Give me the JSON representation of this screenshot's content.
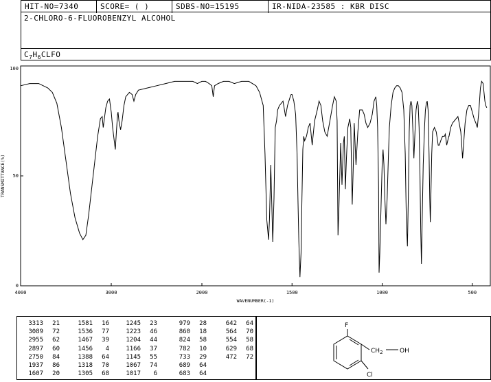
{
  "header": {
    "hit_no": "HIT-NO=7340",
    "score": "SCORE= ( )",
    "sdbs_no": "SDBS-NO=15195",
    "ir_code": "IR-NIDA-23585 : KBR DISC"
  },
  "compound_name": "2-CHLORO-6-FLUOROBENZYL ALCOHOL",
  "formula": {
    "c": "C",
    "c_n": "7",
    "h": "H",
    "h_n": "6",
    "rest": "CLFO"
  },
  "chart_data": {
    "type": "line",
    "xlabel": "WAVENUMBER(-1)",
    "ylabel": "TRANSMITTANCE(%)",
    "xlim": [
      4000,
      400
    ],
    "ylim": [
      0,
      100
    ],
    "x_ticks": [
      "4000",
      "3000",
      "2000",
      "1500",
      "1000",
      "500"
    ],
    "x_tick_values": [
      4000,
      3000,
      2000,
      1500,
      1000,
      500
    ],
    "y_ticks": [
      "100",
      "50",
      "0"
    ],
    "y_tick_values": [
      100,
      50,
      0
    ],
    "series": [
      {
        "points": [
          [
            4000,
            91
          ],
          [
            3900,
            92
          ],
          [
            3800,
            92
          ],
          [
            3750,
            91
          ],
          [
            3700,
            90
          ],
          [
            3650,
            88
          ],
          [
            3600,
            83
          ],
          [
            3550,
            72
          ],
          [
            3500,
            57
          ],
          [
            3450,
            42
          ],
          [
            3400,
            31
          ],
          [
            3350,
            24
          ],
          [
            3313,
            21
          ],
          [
            3280,
            23
          ],
          [
            3250,
            32
          ],
          [
            3200,
            50
          ],
          [
            3150,
            68
          ],
          [
            3120,
            76
          ],
          [
            3100,
            77
          ],
          [
            3089,
            72
          ],
          [
            3070,
            78
          ],
          [
            3060,
            81
          ],
          [
            3040,
            84
          ],
          [
            3020,
            85
          ],
          [
            3000,
            79
          ],
          [
            2985,
            72
          ],
          [
            2955,
            62
          ],
          [
            2940,
            72
          ],
          [
            2930,
            78
          ],
          [
            2925,
            79
          ],
          [
            2915,
            75
          ],
          [
            2897,
            71
          ],
          [
            2880,
            75
          ],
          [
            2860,
            82
          ],
          [
            2840,
            86
          ],
          [
            2800,
            88
          ],
          [
            2770,
            87
          ],
          [
            2750,
            84
          ],
          [
            2730,
            87
          ],
          [
            2700,
            89
          ],
          [
            2600,
            90
          ],
          [
            2500,
            91
          ],
          [
            2400,
            92
          ],
          [
            2300,
            93
          ],
          [
            2200,
            93
          ],
          [
            2100,
            93
          ],
          [
            2050,
            92
          ],
          [
            2000,
            93
          ],
          [
            1980,
            93
          ],
          [
            1960,
            92
          ],
          [
            1945,
            91
          ],
          [
            1937,
            86
          ],
          [
            1930,
            91
          ],
          [
            1910,
            92
          ],
          [
            1880,
            93
          ],
          [
            1850,
            93
          ],
          [
            1820,
            92
          ],
          [
            1780,
            93
          ],
          [
            1740,
            93
          ],
          [
            1720,
            92
          ],
          [
            1700,
            91
          ],
          [
            1680,
            88
          ],
          [
            1660,
            82
          ],
          [
            1650,
            60
          ],
          [
            1640,
            30
          ],
          [
            1630,
            21
          ],
          [
            1625,
            30
          ],
          [
            1618,
            55
          ],
          [
            1607,
            20
          ],
          [
            1600,
            40
          ],
          [
            1593,
            72
          ],
          [
            1586,
            75
          ],
          [
            1580,
            80
          ],
          [
            1570,
            82
          ],
          [
            1560,
            83
          ],
          [
            1550,
            84
          ],
          [
            1536,
            77
          ],
          [
            1525,
            82
          ],
          [
            1510,
            86
          ],
          [
            1505,
            87
          ],
          [
            1500,
            87
          ],
          [
            1490,
            84
          ],
          [
            1480,
            78
          ],
          [
            1472,
            60
          ],
          [
            1467,
            39
          ],
          [
            1462,
            20
          ],
          [
            1456,
            4
          ],
          [
            1450,
            15
          ],
          [
            1445,
            40
          ],
          [
            1440,
            62
          ],
          [
            1435,
            68
          ],
          [
            1430,
            66
          ],
          [
            1420,
            68
          ],
          [
            1410,
            72
          ],
          [
            1400,
            74
          ],
          [
            1388,
            64
          ],
          [
            1375,
            75
          ],
          [
            1360,
            80
          ],
          [
            1350,
            84
          ],
          [
            1340,
            82
          ],
          [
            1330,
            75
          ],
          [
            1318,
            70
          ],
          [
            1305,
            68
          ],
          [
            1290,
            75
          ],
          [
            1275,
            82
          ],
          [
            1265,
            86
          ],
          [
            1255,
            84
          ],
          [
            1250,
            75
          ],
          [
            1245,
            23
          ],
          [
            1240,
            35
          ],
          [
            1230,
            65
          ],
          [
            1223,
            46
          ],
          [
            1215,
            65
          ],
          [
            1210,
            68
          ],
          [
            1204,
            44
          ],
          [
            1198,
            58
          ],
          [
            1190,
            72
          ],
          [
            1180,
            76
          ],
          [
            1174,
            72
          ],
          [
            1166,
            37
          ],
          [
            1160,
            55
          ],
          [
            1155,
            74
          ],
          [
            1145,
            55
          ],
          [
            1135,
            70
          ],
          [
            1125,
            80
          ],
          [
            1110,
            80
          ],
          [
            1100,
            78
          ],
          [
            1090,
            74
          ],
          [
            1080,
            72
          ],
          [
            1067,
            74
          ],
          [
            1055,
            78
          ],
          [
            1045,
            84
          ],
          [
            1035,
            86
          ],
          [
            1030,
            82
          ],
          [
            1025,
            72
          ],
          [
            1020,
            45
          ],
          [
            1017,
            6
          ],
          [
            1013,
            15
          ],
          [
            1005,
            40
          ],
          [
            1000,
            55
          ],
          [
            995,
            62
          ],
          [
            990,
            55
          ],
          [
            985,
            40
          ],
          [
            979,
            28
          ],
          [
            972,
            40
          ],
          [
            965,
            60
          ],
          [
            960,
            72
          ],
          [
            950,
            82
          ],
          [
            940,
            88
          ],
          [
            930,
            90
          ],
          [
            920,
            91
          ],
          [
            910,
            91
          ],
          [
            900,
            90
          ],
          [
            890,
            88
          ],
          [
            880,
            80
          ],
          [
            872,
            60
          ],
          [
            866,
            30
          ],
          [
            860,
            18
          ],
          [
            855,
            40
          ],
          [
            850,
            70
          ],
          [
            845,
            82
          ],
          [
            840,
            84
          ],
          [
            835,
            82
          ],
          [
            830,
            72
          ],
          [
            824,
            58
          ],
          [
            818,
            70
          ],
          [
            812,
            80
          ],
          [
            805,
            84
          ],
          [
            800,
            82
          ],
          [
            795,
            72
          ],
          [
            790,
            50
          ],
          [
            786,
            25
          ],
          [
            782,
            10
          ],
          [
            778,
            30
          ],
          [
            772,
            55
          ],
          [
            765,
            72
          ],
          [
            760,
            80
          ],
          [
            755,
            83
          ],
          [
            750,
            84
          ],
          [
            745,
            80
          ],
          [
            740,
            60
          ],
          [
            736,
            40
          ],
          [
            733,
            29
          ],
          [
            730,
            40
          ],
          [
            725,
            60
          ],
          [
            720,
            70
          ],
          [
            710,
            72
          ],
          [
            700,
            70
          ],
          [
            689,
            64
          ],
          [
            683,
            64
          ],
          [
            675,
            66
          ],
          [
            665,
            68
          ],
          [
            655,
            68
          ],
          [
            650,
            69
          ],
          [
            642,
            64
          ],
          [
            636,
            66
          ],
          [
            630,
            68
          ],
          [
            629,
            68
          ],
          [
            620,
            72
          ],
          [
            610,
            74
          ],
          [
            600,
            75
          ],
          [
            590,
            76
          ],
          [
            580,
            77
          ],
          [
            575,
            75
          ],
          [
            564,
            70
          ],
          [
            560,
            66
          ],
          [
            554,
            58
          ],
          [
            550,
            62
          ],
          [
            545,
            68
          ],
          [
            540,
            74
          ],
          [
            530,
            80
          ],
          [
            520,
            82
          ],
          [
            510,
            82
          ],
          [
            500,
            79
          ],
          [
            490,
            76
          ],
          [
            480,
            74
          ],
          [
            472,
            72
          ],
          [
            465,
            78
          ],
          [
            460,
            84
          ],
          [
            455,
            90
          ],
          [
            448,
            93
          ],
          [
            440,
            92
          ],
          [
            435,
            88
          ],
          [
            430,
            84
          ],
          [
            425,
            82
          ],
          [
            420,
            81
          ]
        ]
      }
    ]
  },
  "peak_table": {
    "columns": [
      [
        [
          "3313",
          "21"
        ],
        [
          "3089",
          "72"
        ],
        [
          "2955",
          "62"
        ],
        [
          "2897",
          "60"
        ],
        [
          "2750",
          "84"
        ],
        [
          "1937",
          "86"
        ],
        [
          "1607",
          "20"
        ]
      ],
      [
        [
          "1581",
          "16"
        ],
        [
          "1536",
          "77"
        ],
        [
          "1467",
          "39"
        ],
        [
          "1456",
          "4"
        ],
        [
          "1388",
          "64"
        ],
        [
          "1318",
          "70"
        ],
        [
          "1305",
          "68"
        ]
      ],
      [
        [
          "1245",
          "23"
        ],
        [
          "1223",
          "46"
        ],
        [
          "1204",
          "44"
        ],
        [
          "1166",
          "37"
        ],
        [
          "1145",
          "55"
        ],
        [
          "1067",
          "74"
        ],
        [
          "1017",
          "6"
        ]
      ],
      [
        [
          "979",
          "28"
        ],
        [
          "860",
          "18"
        ],
        [
          "824",
          "58"
        ],
        [
          "782",
          "10"
        ],
        [
          "733",
          "29"
        ],
        [
          "689",
          "64"
        ],
        [
          "683",
          "64"
        ]
      ],
      [
        [
          "642",
          "64"
        ],
        [
          "564",
          "70"
        ],
        [
          "554",
          "58"
        ],
        [
          "629",
          "68"
        ],
        [
          "472",
          "72"
        ]
      ]
    ]
  },
  "structure": {
    "atom_f": "F",
    "atom_cl": "Cl",
    "group": "CH",
    "group_sub": "2",
    "group_oh": "OH"
  }
}
